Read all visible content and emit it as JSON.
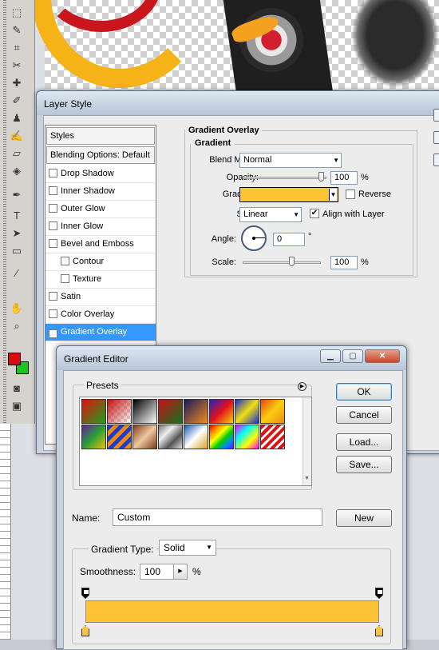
{
  "layer_style": {
    "title": "Layer Style",
    "styles_list": [
      {
        "label": "Styles",
        "type": "header"
      },
      {
        "label": "Blending Options: Default",
        "type": "header"
      },
      {
        "label": "Drop Shadow",
        "checked": false
      },
      {
        "label": "Inner Shadow",
        "checked": false
      },
      {
        "label": "Outer Glow",
        "checked": false
      },
      {
        "label": "Inner Glow",
        "checked": false
      },
      {
        "label": "Bevel and Emboss",
        "checked": false
      },
      {
        "label": "Contour",
        "checked": false,
        "indent": true
      },
      {
        "label": "Texture",
        "checked": false,
        "indent": true
      },
      {
        "label": "Satin",
        "checked": false
      },
      {
        "label": "Color Overlay",
        "checked": false
      },
      {
        "label": "Gradient Overlay",
        "checked": true,
        "selected": true
      }
    ],
    "section_title": "Gradient Overlay",
    "group_title": "Gradient",
    "blend_mode_label": "Blend Mode:",
    "blend_mode_value": "Normal",
    "opacity_label": "Opacity:",
    "opacity_value": "100",
    "opacity_unit": "%",
    "gradient_label": "Gradient:",
    "reverse_label": "Reverse",
    "reverse_checked": false,
    "style_label": "Style:",
    "style_value": "Linear",
    "align_label": "Align with Layer",
    "align_checked": true,
    "angle_label": "Angle:",
    "angle_value": "0",
    "angle_unit": "°",
    "scale_label": "Scale:",
    "scale_value": "100",
    "scale_unit": "%"
  },
  "gradient_editor": {
    "title": "Gradient Editor",
    "presets_label": "Presets",
    "buttons": {
      "ok": "OK",
      "cancel": "Cancel",
      "load": "Load...",
      "save": "Save...",
      "new": "New"
    },
    "name_label": "Name:",
    "name_value": "Custom",
    "gradient_type_label": "Gradient Type:",
    "gradient_type_value": "Solid",
    "smoothness_label": "Smoothness:",
    "smoothness_value": "100",
    "smoothness_unit": "%"
  },
  "colors": {
    "gradient_yellow": "#fdc335",
    "selection_blue": "#3399ff",
    "foreground_color": "#d90d0d",
    "background_color": "#1fc51f"
  },
  "toolbar_icons": [
    "marquee-icon",
    "lasso-icon",
    "crop-icon",
    "slice-icon",
    "healing-icon",
    "brush-icon",
    "stamp-icon",
    "history-brush-icon",
    "eraser-icon",
    "fill-icon",
    "blur-icon",
    "dodge-icon",
    "pen-icon",
    "type-icon",
    "path-select-icon",
    "shape-icon",
    "notes-icon",
    "eyedropper-icon",
    "hand-icon",
    "zoom-icon"
  ]
}
